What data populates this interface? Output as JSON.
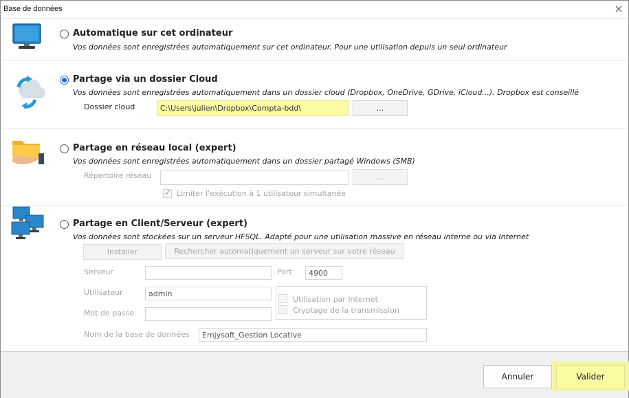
{
  "window": {
    "title": "Base de données"
  },
  "options": [
    {
      "title": "Automatique sur cet ordinateur",
      "description": "Vos données sont enregistrées automatiquement sur cet ordinateur. Pour une utilisation depuis un seul ordinateur",
      "selected": false,
      "icon": "computer-icon"
    },
    {
      "title": "Partage via un dossier Cloud",
      "description": "Vos données sont enregistrées automatiquement dans un dossier cloud (Dropbox, OneDrive, GDrive, iCloud...). Dropbox est conseillé",
      "selected": true,
      "icon": "cloud-sync-icon",
      "folder_label": "Dossier cloud",
      "folder_value": "C:\\Users\\julien\\Dropbox\\Compta-bdd\\",
      "browse_label": "..."
    },
    {
      "title": "Partage en réseau local (expert)",
      "description": "Vos données sont enregistrées automatiquement dans un dossier partagé Windows (SMB)",
      "selected": false,
      "icon": "shared-folder-icon",
      "folder_label": "Répertoire réseau",
      "folder_value": "",
      "browse_label": "...",
      "limit_label": "Limiter l'exécution à 1 utilisateur simultanée",
      "limit_checked": true
    },
    {
      "title": "Partage en Client/Serveur  (expert)",
      "description": "Vos données sont stockées sur un serveur HFSQL. Adapté pour une utilisation massive en réseau interne ou via Internet",
      "selected": false,
      "icon": "network-computers-icon",
      "install_label": "Installer",
      "search_label": "Rechercher automatiquement un serveur sur votre réseau",
      "server_label": "Serveur",
      "server_value": "",
      "port_label": "Port",
      "port_value": "4900",
      "user_label": "Utilisateur",
      "user_value": "admin",
      "password_label": "Mot de passe",
      "password_value": "",
      "internet_label": "Utilisation par Internet",
      "internet_checked": false,
      "encrypt_label": "Cryptage de la transmission",
      "encrypt_checked": false,
      "dbname_label": "Nom de la base de données",
      "dbname_value": "Emjysoft_Gestion Locative"
    }
  ],
  "footer": {
    "cancel_label": "Annuler",
    "validate_label": "Valider"
  },
  "colors": {
    "highlight": "#fbfba4",
    "radio_accent": "#1d6fd1"
  }
}
